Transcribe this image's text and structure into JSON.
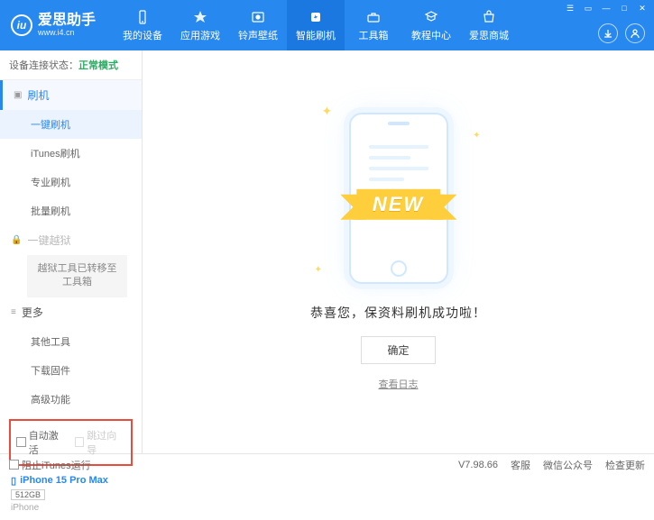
{
  "header": {
    "app_name": "爱思助手",
    "app_url": "www.i4.cn",
    "nav": [
      {
        "label": "我的设备"
      },
      {
        "label": "应用游戏"
      },
      {
        "label": "铃声壁纸"
      },
      {
        "label": "智能刷机"
      },
      {
        "label": "工具箱"
      },
      {
        "label": "教程中心"
      },
      {
        "label": "爱思商城"
      }
    ]
  },
  "sidebar": {
    "status_label": "设备连接状态：",
    "status_value": "正常模式",
    "section_flash": "刷机",
    "items_flash": [
      "一键刷机",
      "iTunes刷机",
      "专业刷机",
      "批量刷机"
    ],
    "section_jailbreak": "一键越狱",
    "jailbreak_note": "越狱工具已转移至工具箱",
    "section_more": "更多",
    "items_more": [
      "其他工具",
      "下载固件",
      "高级功能"
    ],
    "checkbox_auto_activate": "自动激活",
    "checkbox_skip_guide": "跳过向导",
    "device": {
      "name": "iPhone 15 Pro Max",
      "storage": "512GB",
      "type": "iPhone"
    }
  },
  "main": {
    "ribbon": "NEW",
    "success_text": "恭喜您，保资料刷机成功啦！",
    "ok_button": "确定",
    "log_link": "查看日志"
  },
  "footer": {
    "block_itunes": "阻止iTunes运行",
    "version": "V7.98.66",
    "links": [
      "客服",
      "微信公众号",
      "检查更新"
    ]
  }
}
